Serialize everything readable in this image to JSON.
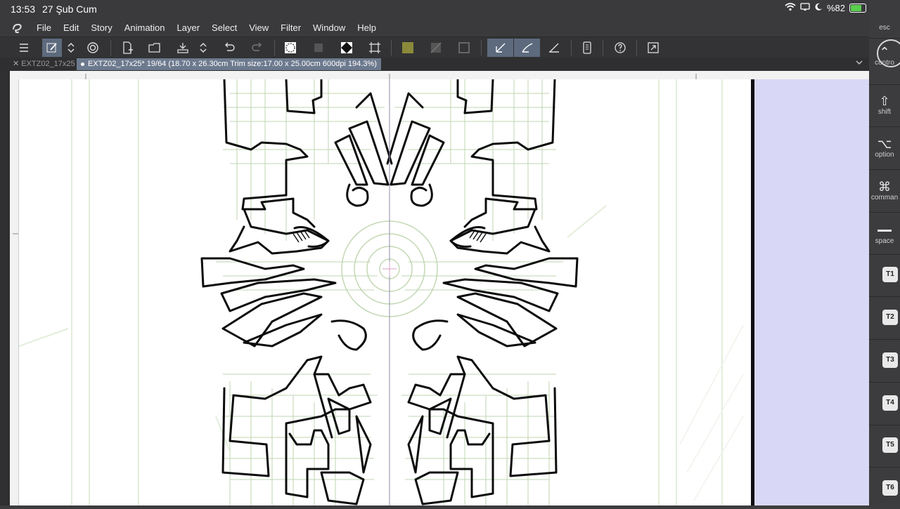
{
  "status": {
    "time": "13:53",
    "date": "27 Şub Cum",
    "battery": "%82"
  },
  "menu": [
    "File",
    "Edit",
    "Story",
    "Animation",
    "Layer",
    "Select",
    "View",
    "Filter",
    "Window",
    "Help"
  ],
  "tabs": {
    "inactive": "EXTZ02_17x25",
    "active": "EXTZ02_17x25* 19/64 (18.70 x 26.30cm Trim size:17.00 x 25.00cm 600dpi 194.3%)"
  },
  "sidekeys": {
    "esc": "esc",
    "control": "contro",
    "shift": "shift",
    "option": "option",
    "command": "comman",
    "space": "space",
    "t1": "T1",
    "t2": "T2",
    "t3": "T3",
    "t4": "T4",
    "t5": "T5",
    "t6": "T6"
  },
  "colors": {
    "accent_active": "#5d6a7e",
    "outside_area": "#d8d8f6",
    "sketch": "#b9d2a8"
  }
}
